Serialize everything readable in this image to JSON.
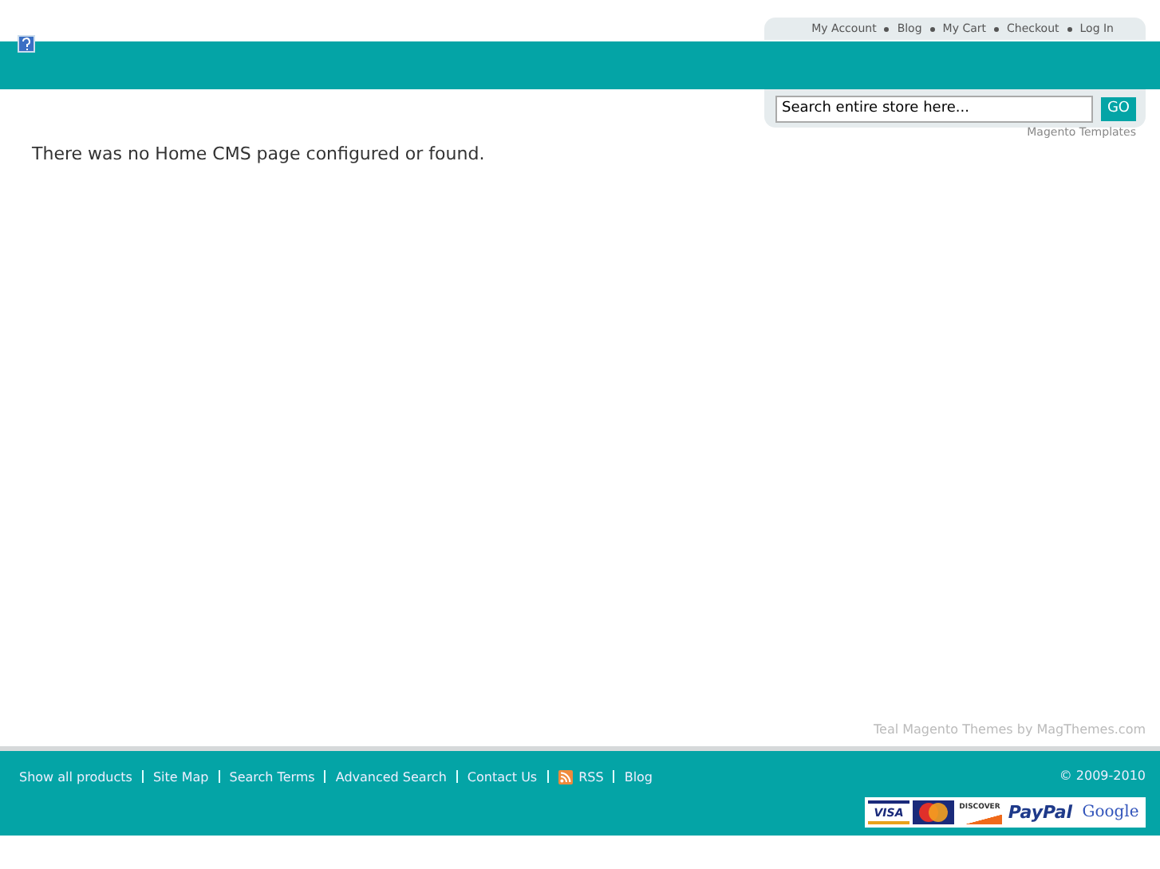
{
  "header": {
    "top_links": [
      "My Account",
      "Blog",
      "My Cart",
      "Checkout",
      "Log In"
    ],
    "search": {
      "placeholder": "Search entire store here...",
      "button": "GO"
    },
    "tagline": "Magento Templates"
  },
  "main": {
    "message": "There was no Home CMS page configured or found."
  },
  "footer": {
    "credit": "Teal Magento Themes by MagThemes.com",
    "links": [
      {
        "label": "Show all products",
        "kind": "link"
      },
      {
        "label": "Site Map",
        "kind": "link"
      },
      {
        "label": "Search Terms",
        "kind": "link"
      },
      {
        "label": "Advanced Search",
        "kind": "link"
      },
      {
        "label": "Contact Us",
        "kind": "link"
      },
      {
        "label": "RSS",
        "kind": "rss"
      },
      {
        "label": "Blog",
        "kind": "link"
      }
    ],
    "copyright": "© 2009-2010",
    "payment_logos": [
      {
        "kind": "visa",
        "text": "VISA"
      },
      {
        "kind": "mastercard"
      },
      {
        "kind": "discover",
        "text": "DISCOVER"
      },
      {
        "kind": "paypal",
        "text": "PayPal"
      },
      {
        "kind": "google",
        "text": "Google"
      }
    ]
  }
}
